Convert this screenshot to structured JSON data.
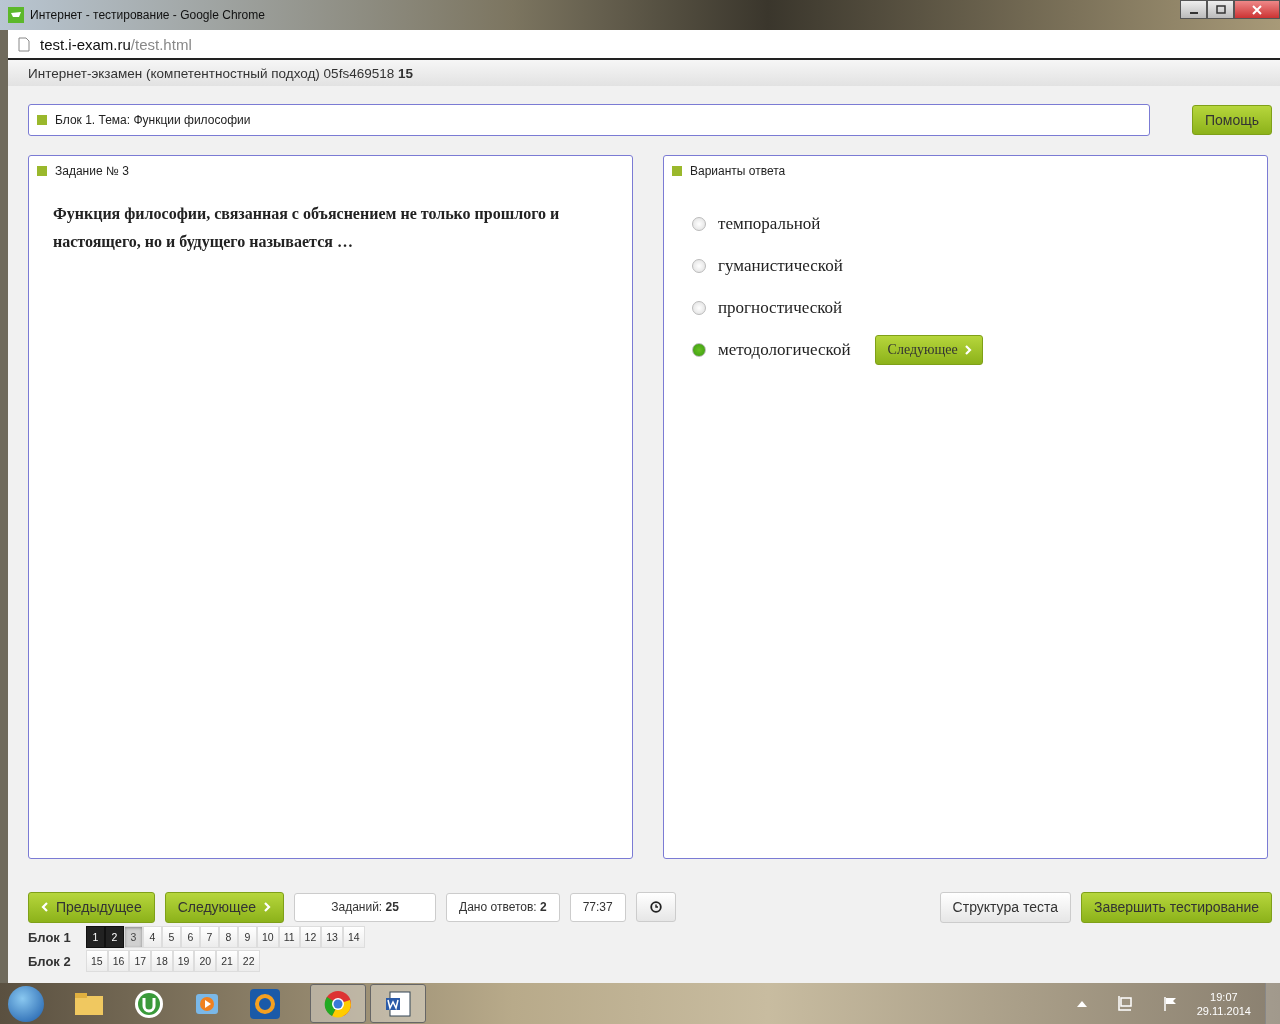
{
  "window": {
    "title": "Интернет - тестирование - Google Chrome"
  },
  "address_bar": {
    "host": "test.i-exam.ru",
    "path": "/test.html"
  },
  "header": {
    "text": "Интернет-экзамен (компетентностный подход) 05fs469518 **15**"
  },
  "topic": {
    "label": "Блок 1. Тема: Функции философии"
  },
  "help_button": "Помощь",
  "task": {
    "heading": "Задание № 3",
    "question": "Функция философии, связанная с объяснением не только прошлого и настоящего, но и будущего называется …"
  },
  "answers": {
    "heading": "Варианты ответа",
    "next_button": "Следующее",
    "options": [
      {
        "label": "темпоральной",
        "selected": false
      },
      {
        "label": "гуманистической",
        "selected": false
      },
      {
        "label": "прогностической",
        "selected": false
      },
      {
        "label": "методологической",
        "selected": true
      }
    ]
  },
  "nav": {
    "prev_button": "Предыдущее",
    "next_button": "Следующее",
    "tasks_count": "Заданий: **25**",
    "answered_count": "Дано ответов: **2**",
    "timer": "77:37",
    "structure_button": "Структура теста",
    "finish_button": "Завершить тестирование"
  },
  "blocks": [
    {
      "label": "Блок 1",
      "items": [
        {
          "number": "1",
          "answered": true,
          "selected": false
        },
        {
          "number": "2",
          "answered": true,
          "selected": false
        },
        {
          "number": "3",
          "answered": false,
          "selected": true
        },
        {
          "number": "4",
          "answered": false,
          "selected": false
        },
        {
          "number": "5",
          "answered": false,
          "selected": false
        },
        {
          "number": "6",
          "answered": false,
          "selected": false
        },
        {
          "number": "7",
          "answered": false,
          "selected": false
        },
        {
          "number": "8",
          "answered": false,
          "selected": false
        },
        {
          "number": "9",
          "answered": false,
          "selected": false
        },
        {
          "number": "10",
          "answered": false,
          "selected": false
        },
        {
          "number": "11",
          "answered": false,
          "selected": false
        },
        {
          "number": "12",
          "answered": false,
          "selected": false
        },
        {
          "number": "13",
          "answered": false,
          "selected": false
        },
        {
          "number": "14",
          "answered": false,
          "selected": false
        }
      ]
    },
    {
      "label": "Блок 2",
      "items": [
        {
          "number": "15",
          "answered": false,
          "selected": false
        },
        {
          "number": "16",
          "answered": false,
          "selected": false
        },
        {
          "number": "17",
          "answered": false,
          "selected": false
        },
        {
          "number": "18",
          "answered": false,
          "selected": false
        },
        {
          "number": "19",
          "answered": false,
          "selected": false
        },
        {
          "number": "20",
          "answered": false,
          "selected": false
        },
        {
          "number": "21",
          "answered": false,
          "selected": false
        },
        {
          "number": "22",
          "answered": false,
          "selected": false
        }
      ]
    }
  ],
  "taskbar": {
    "time": "19:07",
    "date": "29.11.2014"
  }
}
